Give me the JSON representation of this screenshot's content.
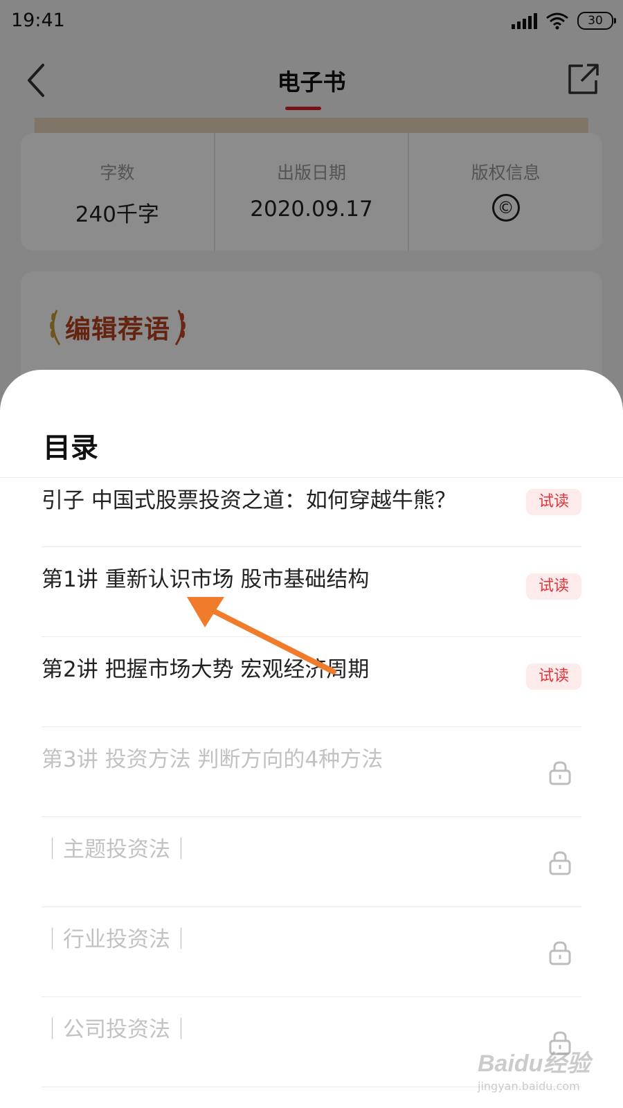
{
  "status_bar": {
    "time": "19:41",
    "battery": "30"
  },
  "nav": {
    "title": "电子书",
    "accent_color": "#d8232a"
  },
  "info": [
    {
      "label": "字数",
      "value": "240千字"
    },
    {
      "label": "出版日期",
      "value": "2020.09.17"
    },
    {
      "label": "版权信息",
      "icon": "copyright-icon",
      "value": "©"
    }
  ],
  "editor": {
    "title": "编辑荐语"
  },
  "toc": {
    "title": "目录",
    "items": [
      {
        "text": "引子 中国式股票投资之道：如何穿越牛熊？",
        "tag": "试读",
        "locked": false
      },
      {
        "text": "第1讲 重新认识市场 股市基础结构",
        "tag": "试读",
        "locked": false
      },
      {
        "text": "第2讲 把握市场大势 宏观经济周期",
        "tag": "试读",
        "locked": false
      },
      {
        "text": "第3讲 投资方法 判断方向的4种方法",
        "tag": "",
        "locked": true
      },
      {
        "text": "｜主题投资法｜",
        "tag": "",
        "locked": true
      },
      {
        "text": "｜行业投资法｜",
        "tag": "",
        "locked": true
      },
      {
        "text": "｜公司投资法｜",
        "tag": "",
        "locked": true
      }
    ]
  },
  "watermark": {
    "logo": "Baidu经验",
    "url": "jingyan.baidu.com"
  }
}
